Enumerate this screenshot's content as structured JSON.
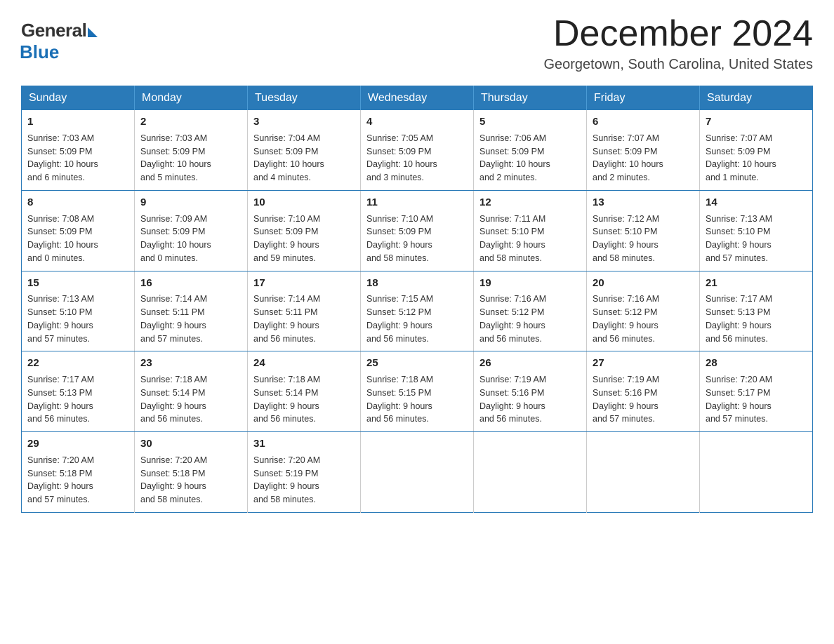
{
  "logo": {
    "general": "General",
    "blue": "Blue"
  },
  "title": {
    "month": "December 2024",
    "location": "Georgetown, South Carolina, United States"
  },
  "days_of_week": [
    "Sunday",
    "Monday",
    "Tuesday",
    "Wednesday",
    "Thursday",
    "Friday",
    "Saturday"
  ],
  "weeks": [
    [
      {
        "day": "1",
        "sunrise": "7:03 AM",
        "sunset": "5:09 PM",
        "daylight": "10 hours and 6 minutes."
      },
      {
        "day": "2",
        "sunrise": "7:03 AM",
        "sunset": "5:09 PM",
        "daylight": "10 hours and 5 minutes."
      },
      {
        "day": "3",
        "sunrise": "7:04 AM",
        "sunset": "5:09 PM",
        "daylight": "10 hours and 4 minutes."
      },
      {
        "day": "4",
        "sunrise": "7:05 AM",
        "sunset": "5:09 PM",
        "daylight": "10 hours and 3 minutes."
      },
      {
        "day": "5",
        "sunrise": "7:06 AM",
        "sunset": "5:09 PM",
        "daylight": "10 hours and 2 minutes."
      },
      {
        "day": "6",
        "sunrise": "7:07 AM",
        "sunset": "5:09 PM",
        "daylight": "10 hours and 2 minutes."
      },
      {
        "day": "7",
        "sunrise": "7:07 AM",
        "sunset": "5:09 PM",
        "daylight": "10 hours and 1 minute."
      }
    ],
    [
      {
        "day": "8",
        "sunrise": "7:08 AM",
        "sunset": "5:09 PM",
        "daylight": "10 hours and 0 minutes."
      },
      {
        "day": "9",
        "sunrise": "7:09 AM",
        "sunset": "5:09 PM",
        "daylight": "10 hours and 0 minutes."
      },
      {
        "day": "10",
        "sunrise": "7:10 AM",
        "sunset": "5:09 PM",
        "daylight": "9 hours and 59 minutes."
      },
      {
        "day": "11",
        "sunrise": "7:10 AM",
        "sunset": "5:09 PM",
        "daylight": "9 hours and 58 minutes."
      },
      {
        "day": "12",
        "sunrise": "7:11 AM",
        "sunset": "5:10 PM",
        "daylight": "9 hours and 58 minutes."
      },
      {
        "day": "13",
        "sunrise": "7:12 AM",
        "sunset": "5:10 PM",
        "daylight": "9 hours and 58 minutes."
      },
      {
        "day": "14",
        "sunrise": "7:13 AM",
        "sunset": "5:10 PM",
        "daylight": "9 hours and 57 minutes."
      }
    ],
    [
      {
        "day": "15",
        "sunrise": "7:13 AM",
        "sunset": "5:10 PM",
        "daylight": "9 hours and 57 minutes."
      },
      {
        "day": "16",
        "sunrise": "7:14 AM",
        "sunset": "5:11 PM",
        "daylight": "9 hours and 57 minutes."
      },
      {
        "day": "17",
        "sunrise": "7:14 AM",
        "sunset": "5:11 PM",
        "daylight": "9 hours and 56 minutes."
      },
      {
        "day": "18",
        "sunrise": "7:15 AM",
        "sunset": "5:12 PM",
        "daylight": "9 hours and 56 minutes."
      },
      {
        "day": "19",
        "sunrise": "7:16 AM",
        "sunset": "5:12 PM",
        "daylight": "9 hours and 56 minutes."
      },
      {
        "day": "20",
        "sunrise": "7:16 AM",
        "sunset": "5:12 PM",
        "daylight": "9 hours and 56 minutes."
      },
      {
        "day": "21",
        "sunrise": "7:17 AM",
        "sunset": "5:13 PM",
        "daylight": "9 hours and 56 minutes."
      }
    ],
    [
      {
        "day": "22",
        "sunrise": "7:17 AM",
        "sunset": "5:13 PM",
        "daylight": "9 hours and 56 minutes."
      },
      {
        "day": "23",
        "sunrise": "7:18 AM",
        "sunset": "5:14 PM",
        "daylight": "9 hours and 56 minutes."
      },
      {
        "day": "24",
        "sunrise": "7:18 AM",
        "sunset": "5:14 PM",
        "daylight": "9 hours and 56 minutes."
      },
      {
        "day": "25",
        "sunrise": "7:18 AM",
        "sunset": "5:15 PM",
        "daylight": "9 hours and 56 minutes."
      },
      {
        "day": "26",
        "sunrise": "7:19 AM",
        "sunset": "5:16 PM",
        "daylight": "9 hours and 56 minutes."
      },
      {
        "day": "27",
        "sunrise": "7:19 AM",
        "sunset": "5:16 PM",
        "daylight": "9 hours and 57 minutes."
      },
      {
        "day": "28",
        "sunrise": "7:20 AM",
        "sunset": "5:17 PM",
        "daylight": "9 hours and 57 minutes."
      }
    ],
    [
      {
        "day": "29",
        "sunrise": "7:20 AM",
        "sunset": "5:18 PM",
        "daylight": "9 hours and 57 minutes."
      },
      {
        "day": "30",
        "sunrise": "7:20 AM",
        "sunset": "5:18 PM",
        "daylight": "9 hours and 58 minutes."
      },
      {
        "day": "31",
        "sunrise": "7:20 AM",
        "sunset": "5:19 PM",
        "daylight": "9 hours and 58 minutes."
      },
      null,
      null,
      null,
      null
    ]
  ],
  "labels": {
    "sunrise": "Sunrise:",
    "sunset": "Sunset:",
    "daylight": "Daylight:"
  }
}
